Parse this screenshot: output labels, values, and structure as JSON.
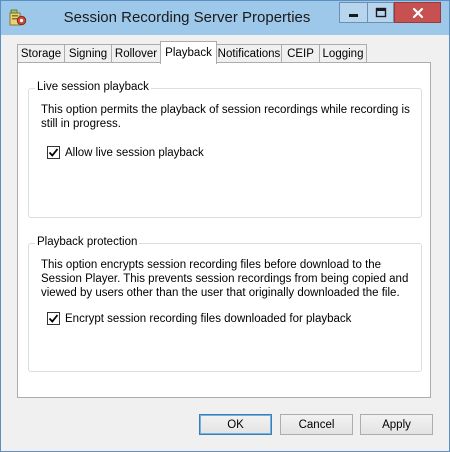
{
  "window": {
    "title": "Session Recording Server Properties",
    "icon": "server-properties-icon"
  },
  "titlebar_buttons": {
    "minimize": "minimize-icon",
    "maximize": "maximize-icon",
    "close": "close-icon"
  },
  "tabs": [
    {
      "label": "Storage",
      "active": false
    },
    {
      "label": "Signing",
      "active": false
    },
    {
      "label": "Rollover",
      "active": false
    },
    {
      "label": "Playback",
      "active": true
    },
    {
      "label": "Notifications",
      "active": false
    },
    {
      "label": "CEIP",
      "active": false
    },
    {
      "label": "Logging",
      "active": false
    }
  ],
  "live_playback": {
    "group_label": "Live session playback",
    "description_line1": "This option permits the playback of session recordings while recording is",
    "description_line2": "still in progress.",
    "checkbox_label": "Allow live session playback",
    "checked": true
  },
  "protection": {
    "group_label": "Playback protection",
    "description_line1": "This option encrypts session recording files before download to the",
    "description_line2": "Session Player. This prevents session recordings from being copied and",
    "description_line3": "viewed by users other than the user that originally downloaded the file.",
    "checkbox_label": "Encrypt session recording files downloaded for playback",
    "checked": true
  },
  "buttons": {
    "ok": "OK",
    "cancel": "Cancel",
    "apply": "Apply"
  },
  "colors": {
    "titlebar": "#9ec8ea",
    "close_button": "#c75050",
    "window_bg": "#f0f0f0"
  }
}
